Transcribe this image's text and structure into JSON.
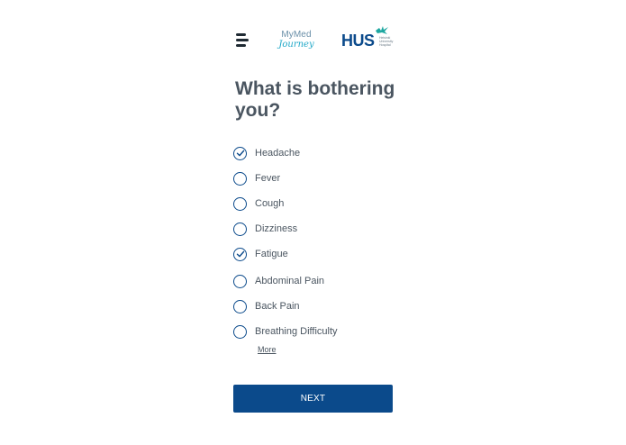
{
  "header": {
    "app_logo": {
      "line1": "MyMed",
      "line2": "Journey"
    },
    "hospital_logo": {
      "text": "HUS",
      "tagline": "Helsinki University Hospital",
      "color": "#0b4a8b",
      "bird_color": "#1ea7a0"
    }
  },
  "question": {
    "title": "What is bothering you?"
  },
  "options": [
    {
      "label": "Headache",
      "checked": true
    },
    {
      "label": "Fever",
      "checked": false
    },
    {
      "label": "Cough",
      "checked": false
    },
    {
      "label": "Dizziness",
      "checked": false
    },
    {
      "label": "Fatigue",
      "checked": true
    },
    {
      "label": "Abdominal Pain",
      "checked": false
    },
    {
      "label": "Back Pain",
      "checked": false
    },
    {
      "label": "Breathing Difficulty",
      "checked": false
    }
  ],
  "more_link": "More",
  "next_button": "NEXT",
  "colors": {
    "accent": "#0b4a8b",
    "text": "#4a5560"
  }
}
